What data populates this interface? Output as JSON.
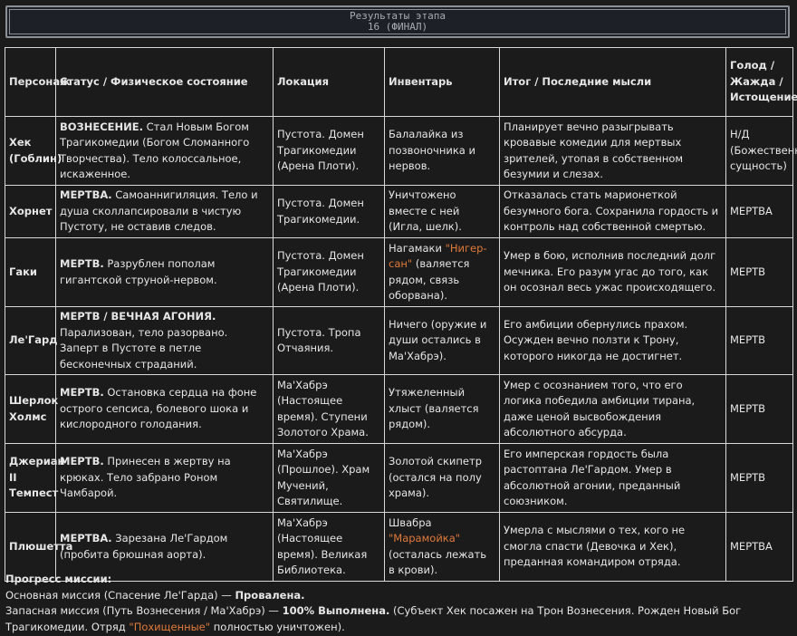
{
  "banner": {
    "title": "Результаты этапа",
    "subtitle": "16 (ФИНАЛ)"
  },
  "table": {
    "headers": {
      "character": "Персонаж",
      "status": "Статус / Физическое состояние",
      "location": "Локация",
      "inventory": "Инвентарь",
      "outcome": "Итог / Последние мысли",
      "hunger": "Голод / Жажда / Истощение"
    },
    "rows": [
      {
        "name": "Хек (Гоблин)",
        "status_bold": "ВОЗНЕСЕНИЕ.",
        "status_text": " Стал Новым Богом Трагикомедии (Богом Сломанного Творчества). Тело колоссальное, искаженное.",
        "location": "Пустота. Домен Трагикомедии (Арена Плоти).",
        "inv_pre": "Балалайка из позвоночника и нервов.",
        "inv_hl": "",
        "inv_post": "",
        "outcome": "Планирует вечно разыгрывать кровавые комедии для мертвых зрителей, утопая в собственном безумии и слезах.",
        "hunger": "Н/Д (Божественная сущность)"
      },
      {
        "name": "Хорнет",
        "status_bold": "МЕРТВА.",
        "status_text": " Самоаннигиляция. Тело и душа сколлапсировали в чистую Пустоту, не оставив следов.",
        "location": "Пустота. Домен Трагикомедии.",
        "inv_pre": "Уничтожено вместе с ней (Игла, шелк).",
        "inv_hl": "",
        "inv_post": "",
        "outcome": "Отказалась стать марионеткой безумного бога. Сохранила гордость и контроль над собственной смертью.",
        "hunger": "МЕРТВА"
      },
      {
        "name": "Гаки",
        "status_bold": "МЕРТВ.",
        "status_text": " Разрублен пополам гигантской струной-нервом.",
        "location": "Пустота. Домен Трагикомедии (Арена Плоти).",
        "inv_pre": "Нагамаки ",
        "inv_hl": "\"Нигер-сан\"",
        "inv_post": " (валяется рядом, связь оборвана).",
        "outcome": "Умер в бою, исполнив последний долг мечника. Его разум угас до того, как он осознал весь ужас происходящего.",
        "hunger": "МЕРТВ"
      },
      {
        "name": "Ле'Гард",
        "status_bold": "МЕРТВ / ВЕЧНАЯ АГОНИЯ.",
        "status_text": " Парализован, тело разорвано. Заперт в Пустоте в петле бесконечных страданий.",
        "location": "Пустота. Тропа Отчаяния.",
        "inv_pre": "Ничего (оружие и души остались в Ма'Хабрэ).",
        "inv_hl": "",
        "inv_post": "",
        "outcome": "Его амбиции обернулись прахом. Осужден вечно ползти к Трону, которого никогда не достигнет.",
        "hunger": "МЕРТВ"
      },
      {
        "name": "Шерлок Холмс",
        "status_bold": "МЕРТВ.",
        "status_text": " Остановка сердца на фоне острого сепсиса, болевого шока и кислородного голодания.",
        "location": "Ма'Хабрэ (Настоящее время). Ступени Золотого Храма.",
        "inv_pre": "Утяжеленный хлыст (валяется рядом).",
        "inv_hl": "",
        "inv_post": "",
        "outcome": "Умер с осознанием того, что его логика победила амбиции тирана, даже ценой высвобождения абсолютного абсурда.",
        "hunger": "МЕРТВ"
      },
      {
        "name": "Джериан II Темпест",
        "status_bold": "МЕРТВ.",
        "status_text": " Принесен в жертву на крюках. Тело забрано Роном Чамбарой.",
        "location": "Ма'Хабрэ (Прошлое). Храм Мучений, Святилище.",
        "inv_pre": "Золотой скипетр (остался на полу храма).",
        "inv_hl": "",
        "inv_post": "",
        "outcome": "Его имперская гордость была растоптана Ле'Гардом. Умер в абсолютной агонии, преданный союзником.",
        "hunger": "МЕРТВ"
      },
      {
        "name": "Плюшетта",
        "status_bold": "МЕРТВА.",
        "status_text": " Зарезана Ле'Гардом (пробита брюшная аорта).",
        "location": "Ма'Хабрэ (Настоящее время). Великая Библиотека.",
        "inv_pre": "Швабра ",
        "inv_hl": "\"Марамойка\"",
        "inv_post": " (осталась лежать в крови).",
        "outcome": "Умерла с мыслями о тех, кого не смогла спасти (Девочка и Хек), преданная командиром отряда.",
        "hunger": "МЕРТВА"
      }
    ]
  },
  "progress": {
    "title": "Прогресс миссии:",
    "main_label": "Основная миссия (Спасение Ле'Гарда) — ",
    "main_status": "Провалена.",
    "backup_label": "Запасная миссия (Путь Вознесения / Ма'Хабрэ) — ",
    "backup_status": "100% Выполнена.",
    "backup_note": " (Субъект Хек посажен на Трон Вознесения. Рожден Новый Бог Трагикомедии. Отряд ",
    "squad_name": "\"Похищенные\"",
    "backup_end": " полностью уничтожен)."
  }
}
